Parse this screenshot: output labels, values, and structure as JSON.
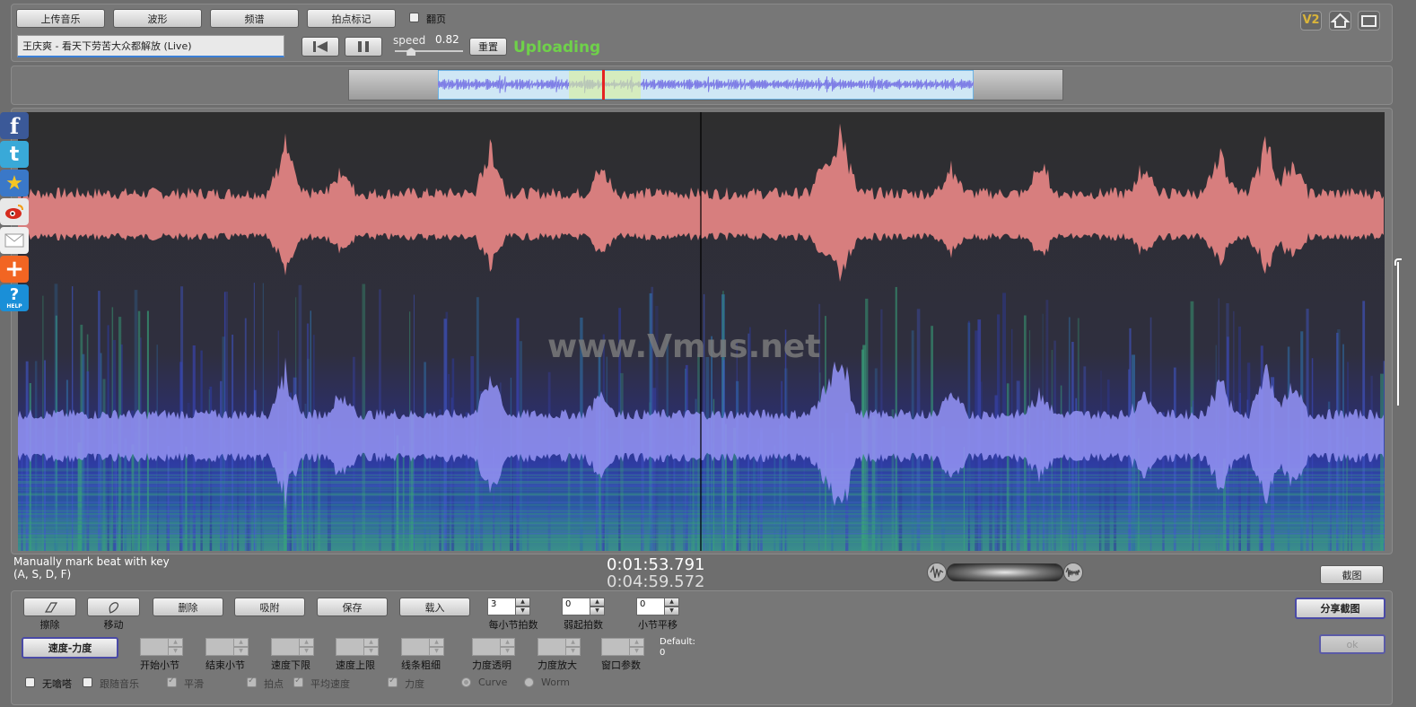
{
  "toolbar": {
    "upload": "上传音乐",
    "waveform": "波形",
    "spectrum": "频谱",
    "beat_mark": "拍点标记",
    "page_flip": "翻页",
    "song_title": "王庆爽 - 看天下劳苦大众都解放 (Live)",
    "speed_label": "speed",
    "speed_value": "0.82",
    "speed_level": 0.2,
    "redraw": "重置",
    "status": "Uploading",
    "version_badge": "V2"
  },
  "share_icons": [
    "facebook-icon",
    "twitter-icon",
    "favorite-star-icon",
    "weibo-icon",
    "email-icon",
    "add-share-icon",
    "help-icon"
  ],
  "help_text": "HELP",
  "watermark": "www.Vmus.net",
  "status_bar": {
    "hint_line1": "Manually mark beat with key",
    "hint_line2": "(A, S, D, F)",
    "current_time": "0:01:53.791",
    "total_time": "0:04:59.572",
    "screenshot": "截图"
  },
  "tools": {
    "erase_caption": "擦除",
    "move_caption": "移动",
    "delete": "删除",
    "snap": "吸附",
    "save": "保存",
    "load": "载入",
    "beats_per_bar": {
      "value": "3",
      "caption": "每小节拍数"
    },
    "weak_beats": {
      "value": "0",
      "caption": "弱起拍数"
    },
    "bar_offset": {
      "value": "0",
      "caption": "小节平移"
    },
    "share_screenshot": "分享截图",
    "ok": "ok",
    "speed_force": "速度-力度",
    "params": [
      "开始小节",
      "结束小节",
      "速度下限",
      "速度上限",
      "线条粗细",
      "力度透明",
      "力度放大",
      "窗口参数"
    ],
    "default_label": "Default:",
    "default_value": "0"
  },
  "options": {
    "no_drift": "无噏嗒",
    "follow_music": "跟随音乐",
    "smooth": "平滑",
    "beat_points": "拍点",
    "avg_speed": "平均速度",
    "force": "力度",
    "curve": "Curve",
    "worm": "Worm"
  },
  "colors": {
    "waveform_top": "#d77e7e",
    "waveform_bottom": "#8f8ff0",
    "spectrogram_bg": "#2e2e2e",
    "overview_wave": "#8080e8",
    "status_green": "#6fd14a",
    "version_badge": "#d9b43a"
  }
}
